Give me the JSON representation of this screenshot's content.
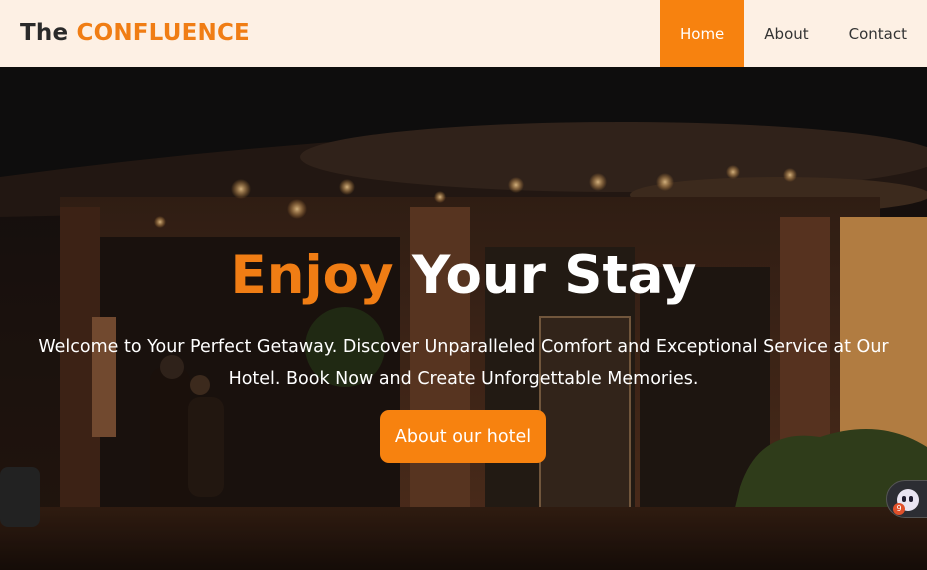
{
  "brand": {
    "prefix": "The",
    "name": "CONFLUENCE"
  },
  "nav": {
    "items": [
      {
        "label": "Home",
        "active": true
      },
      {
        "label": "About",
        "active": false
      },
      {
        "label": "Contact",
        "active": false
      }
    ]
  },
  "hero": {
    "headline_accent": "Enjoy",
    "headline_rest": "Your Stay",
    "subtext": "Welcome to Your Perfect Getaway. Discover Unparalleled Comfort and Exceptional Service at Our Hotel. Book Now and Create Unforgettable Memories.",
    "cta_label": "About our hotel"
  },
  "widget": {
    "badge_count": "9"
  },
  "colors": {
    "accent": "#f7820f",
    "nav_bg": "#fdf0e4",
    "brand_text": "#2a2a2a"
  },
  "icons": {
    "widget": "assistant-face-icon"
  }
}
